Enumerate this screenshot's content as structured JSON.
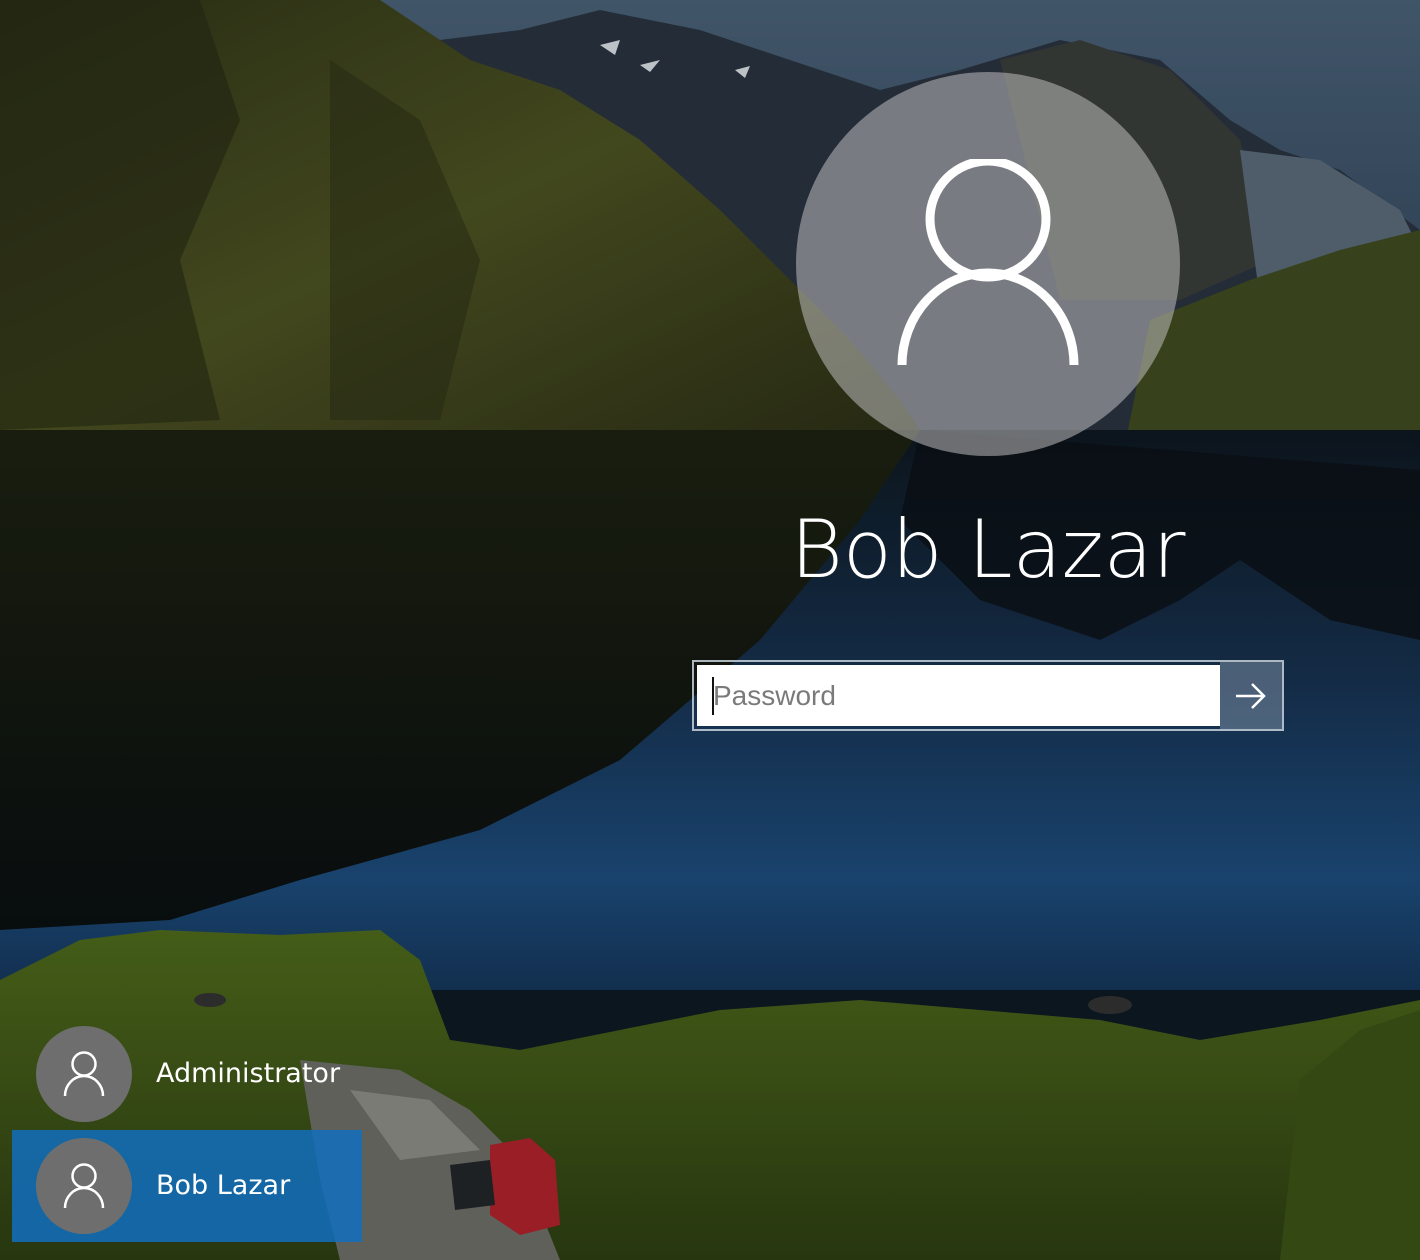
{
  "main_user": {
    "name": "Bob Lazar",
    "avatar_icon": "user-icon"
  },
  "login": {
    "password_placeholder": "Password",
    "submit_icon": "arrow-right-icon"
  },
  "user_list": [
    {
      "label": "Administrator",
      "icon": "user-icon",
      "selected": false
    },
    {
      "label": "Bob Lazar",
      "icon": "user-icon",
      "selected": true
    }
  ],
  "colors": {
    "selected_bg": "#106ebe",
    "avatar_bg": "#6e6e6e",
    "text": "#ffffff"
  }
}
